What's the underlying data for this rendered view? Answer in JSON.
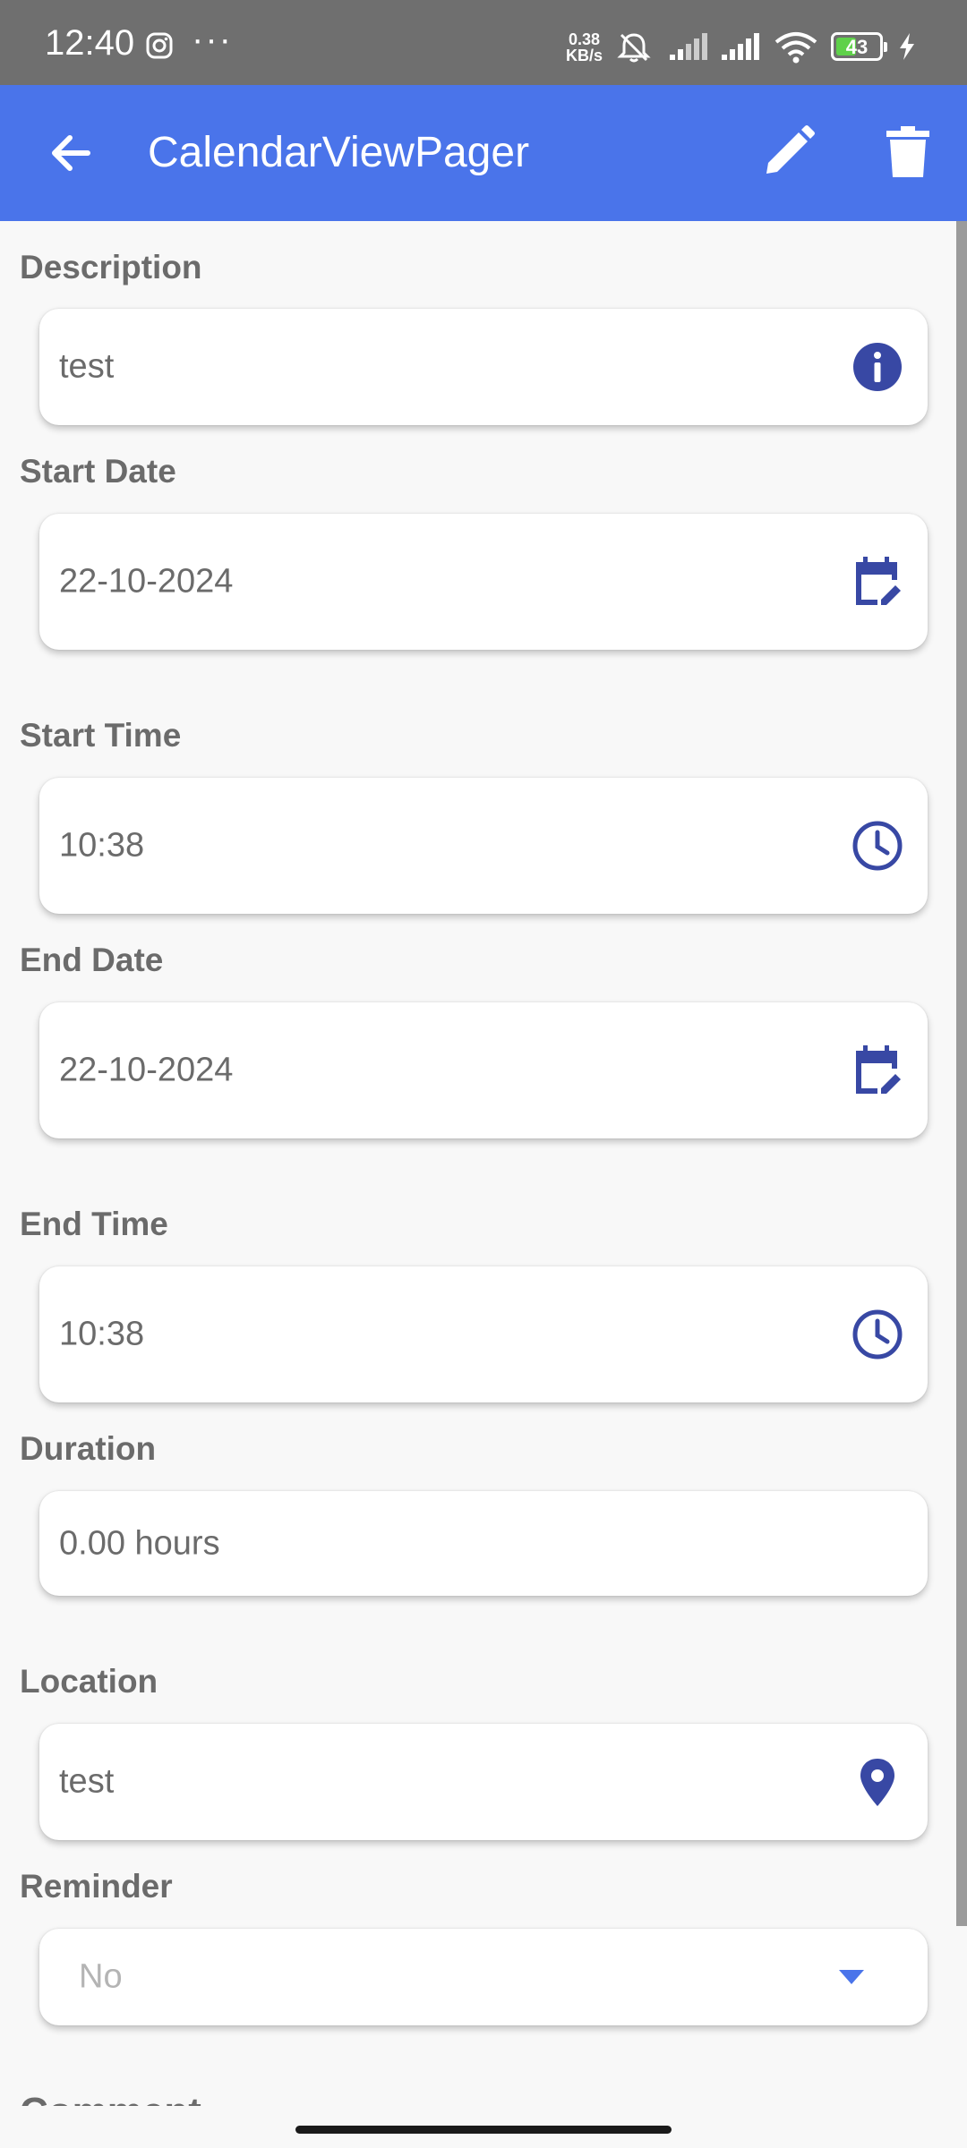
{
  "status_bar": {
    "time": "12:40",
    "dots": "···",
    "net_speed_value": "0.38",
    "net_speed_unit": "KB/s",
    "battery_level": "43",
    "icons": [
      "instagram-icon",
      "mute-icon",
      "signal-icon",
      "signal-icon",
      "wifi-icon",
      "battery-icon",
      "charging-icon"
    ]
  },
  "app_bar": {
    "title": "CalendarViewPager",
    "color": "#4a74ea",
    "icons": [
      "back-arrow-icon",
      "edit-icon",
      "delete-icon"
    ]
  },
  "form": {
    "description": {
      "label": "Description",
      "value": "test",
      "icon": "info-icon"
    },
    "start_date": {
      "label": "Start Date",
      "value": "22-10-2024",
      "icon": "calendar-edit-icon"
    },
    "start_time": {
      "label": "Start Time",
      "value": "10:38",
      "icon": "clock-icon"
    },
    "end_date": {
      "label": "End Date",
      "value": "22-10-2024",
      "icon": "calendar-edit-icon"
    },
    "end_time": {
      "label": "End Time",
      "value": "10:38",
      "icon": "clock-icon"
    },
    "duration": {
      "label": "Duration",
      "value": "0.00 hours"
    },
    "location": {
      "label": "Location",
      "value": "test",
      "icon": "location-pin-icon"
    },
    "reminder": {
      "label": "Reminder",
      "value": "No",
      "icon": "dropdown-caret-icon"
    },
    "comment": {
      "label": "Comment"
    }
  },
  "colors": {
    "icon_accent": "#3848a4",
    "dropdown_accent": "#4a74ea",
    "label_text": "#6b6b6b"
  }
}
